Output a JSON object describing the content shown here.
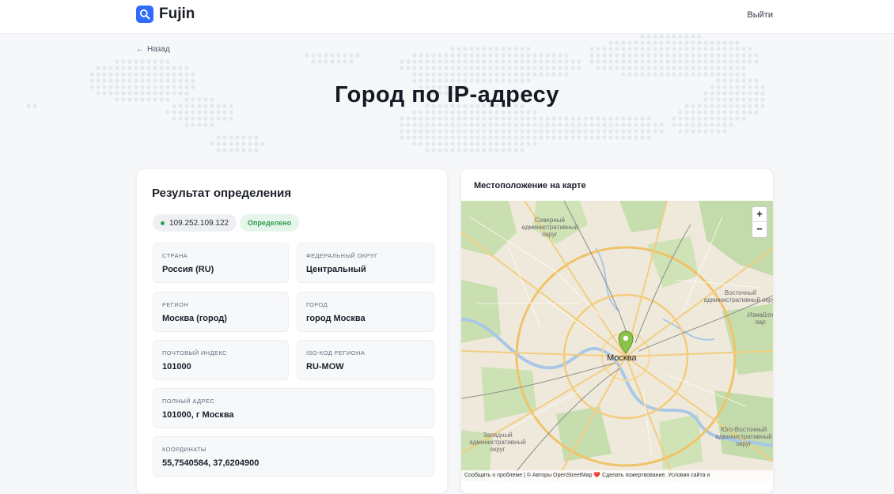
{
  "header": {
    "brand": "Fujin",
    "logout_label": "Выйти"
  },
  "hero": {
    "back_label": "Назад",
    "title": "Город по IP-адресу"
  },
  "result": {
    "title": "Результат определения",
    "ip": "109.252.109.122",
    "status": "Определено",
    "fields": {
      "country": {
        "label": "Страна",
        "value": "Россия (RU)"
      },
      "district": {
        "label": "Федеральный округ",
        "value": "Центральный"
      },
      "region": {
        "label": "Регион",
        "value": "Москва (город)"
      },
      "city": {
        "label": "Город",
        "value": "город Москва"
      },
      "postal": {
        "label": "Почтовый индекс",
        "value": "101000"
      },
      "iso": {
        "label": "ISO-код региона",
        "value": "RU-MOW"
      },
      "address": {
        "label": "Полный адрес",
        "value": "101000, г Москва"
      },
      "coords": {
        "label": "Координаты",
        "value": "55,7540584, 37,6204900"
      }
    }
  },
  "map": {
    "title": "Местоположение на карте",
    "zoom_in": "+",
    "zoom_out": "−",
    "city_label": "Москва",
    "labels": {
      "north": "Северный административный округ",
      "east": "Восточный административный округ",
      "izmaylovo": "Измайло пар",
      "west": "Западный административный округ",
      "southeast": "Юго-Восточный административный округ"
    },
    "attribution": "Сообщить о проблеме | © Авторы OpenStreetMap ❤️ Сделать пожертвование. Условия сайта и"
  },
  "colors": {
    "accent": "#2f6bff",
    "success": "#2a9b4d",
    "marker": "#8bc34a"
  },
  "icons": {
    "logo": "search-icon",
    "back": "arrow-left-icon",
    "marker": "map-pin-icon"
  }
}
